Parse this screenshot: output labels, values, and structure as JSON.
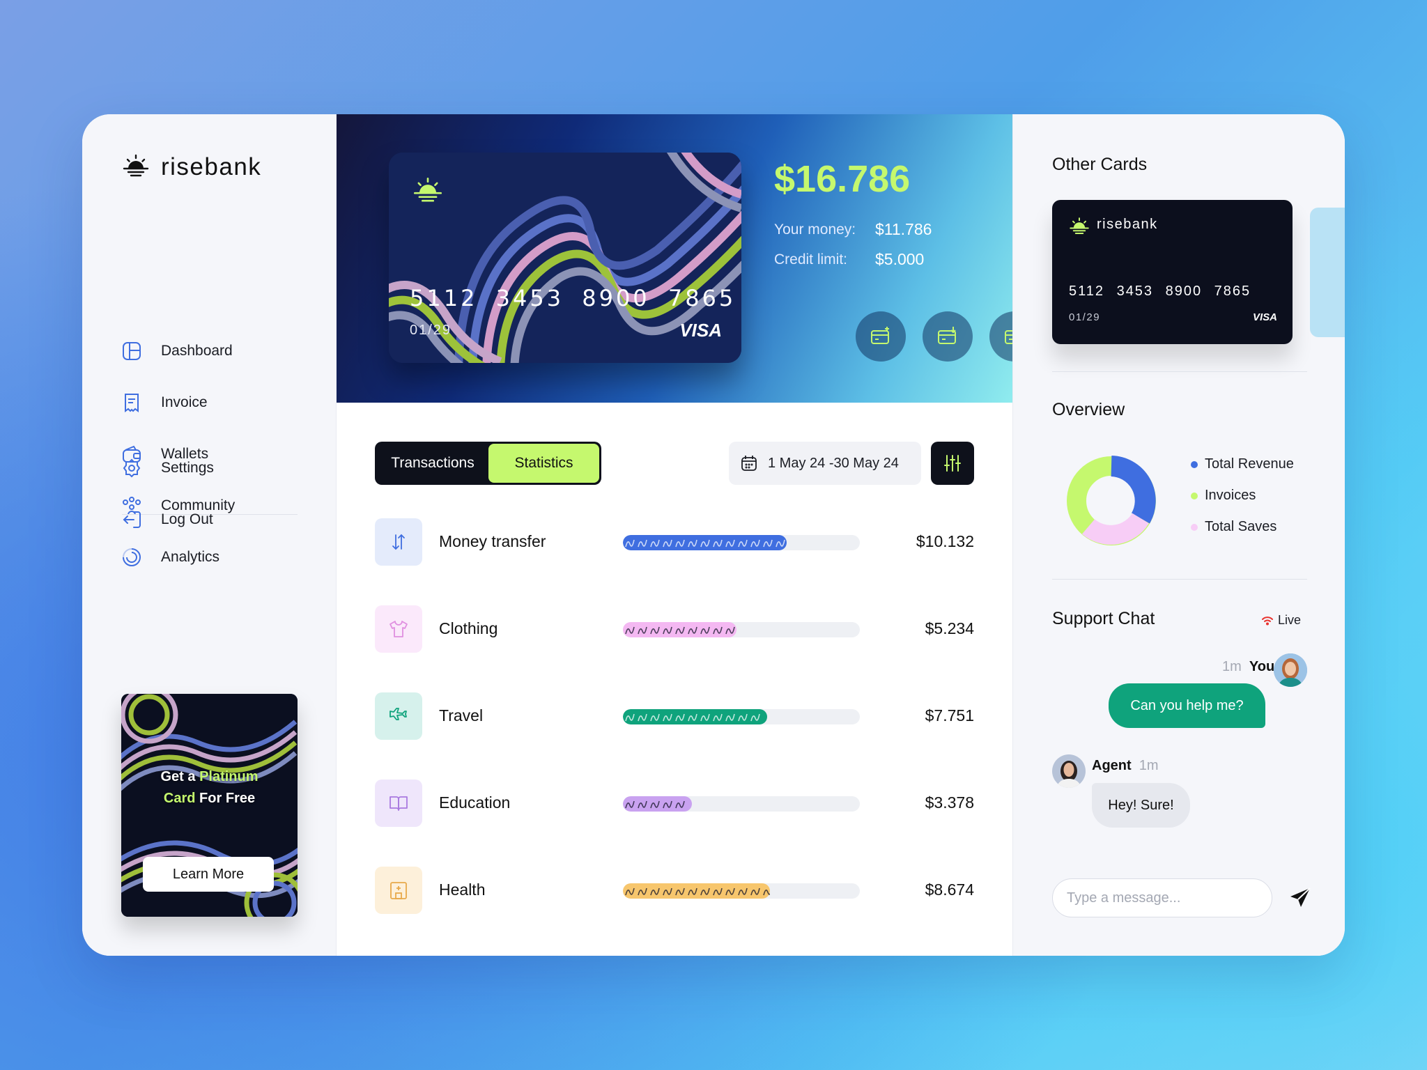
{
  "brand": {
    "name": "risebank"
  },
  "nav": {
    "items": [
      {
        "label": "Dashboard",
        "icon": "dashboard-icon"
      },
      {
        "label": "Invoice",
        "icon": "invoice-icon"
      },
      {
        "label": "Wallets",
        "icon": "wallet-icon"
      },
      {
        "label": "Community",
        "icon": "community-icon"
      },
      {
        "label": "Analytics",
        "icon": "analytics-icon"
      }
    ],
    "bottom": [
      {
        "label": "Settings",
        "icon": "gear-icon"
      },
      {
        "label": "Log Out",
        "icon": "logout-icon"
      }
    ]
  },
  "promo": {
    "line1_pre": "Get a ",
    "line1_hl": "Platinum",
    "line2_hl": "Card",
    "line2_post": " For Free",
    "button": "Learn More"
  },
  "main_card": {
    "number": "5112 3453 8900 7865",
    "expiry": "01/29",
    "network": "VISA"
  },
  "balance": {
    "total": "$16.786",
    "your_money_label": "Your money:",
    "your_money": "$11.786",
    "credit_limit_label": "Credit limit:",
    "credit_limit": "$5.000",
    "actions": [
      "card-add-icon",
      "card-download-icon",
      "card-edit-icon"
    ]
  },
  "tabs": {
    "transactions": "Transactions",
    "statistics": "Statistics",
    "active": "Statistics"
  },
  "date_range": "1 May 24 -30 May 24",
  "transactions": [
    {
      "name": "Money transfer",
      "amount": "$10.132",
      "progress": 0.69,
      "color": "#3f6ee0",
      "icon_bg": "#e4ebfb",
      "icon": "transfer-icon"
    },
    {
      "name": "Clothing",
      "amount": "$5.234",
      "progress": 0.48,
      "color": "#f4b8f2",
      "icon_bg": "#fbe9fb",
      "icon": "shirt-icon"
    },
    {
      "name": "Travel",
      "amount": "$7.751",
      "progress": 0.61,
      "color": "#0fa37c",
      "icon_bg": "#d6f1ec",
      "icon": "plane-icon"
    },
    {
      "name": "Education",
      "amount": "$3.378",
      "progress": 0.29,
      "color": "#c9a2f0",
      "icon_bg": "#efe6fb",
      "icon": "book-icon"
    },
    {
      "name": "Health",
      "amount": "$8.674",
      "progress": 0.62,
      "color": "#f7c66d",
      "icon_bg": "#fdf0da",
      "icon": "hospital-icon"
    }
  ],
  "other_cards": {
    "title": "Other Cards",
    "card": {
      "brand": "risebank",
      "number": "5112 3453 8900 7865",
      "expiry": "01/29",
      "network": "VISA"
    }
  },
  "overview": {
    "title": "Overview",
    "legend": [
      {
        "label": "Total Revenue",
        "color": "#3f6ee0"
      },
      {
        "label": "Invoices",
        "color": "#c5f86e"
      },
      {
        "label": "Total Saves",
        "color": "#f7cdf6"
      }
    ]
  },
  "support": {
    "title": "Support Chat",
    "live": "Live",
    "me": {
      "who": "You",
      "time": "1m",
      "text": "Can you help me?"
    },
    "agent": {
      "who": "Agent",
      "time": "1m",
      "text": "Hey! Sure!"
    },
    "placeholder": "Type a message..."
  }
}
